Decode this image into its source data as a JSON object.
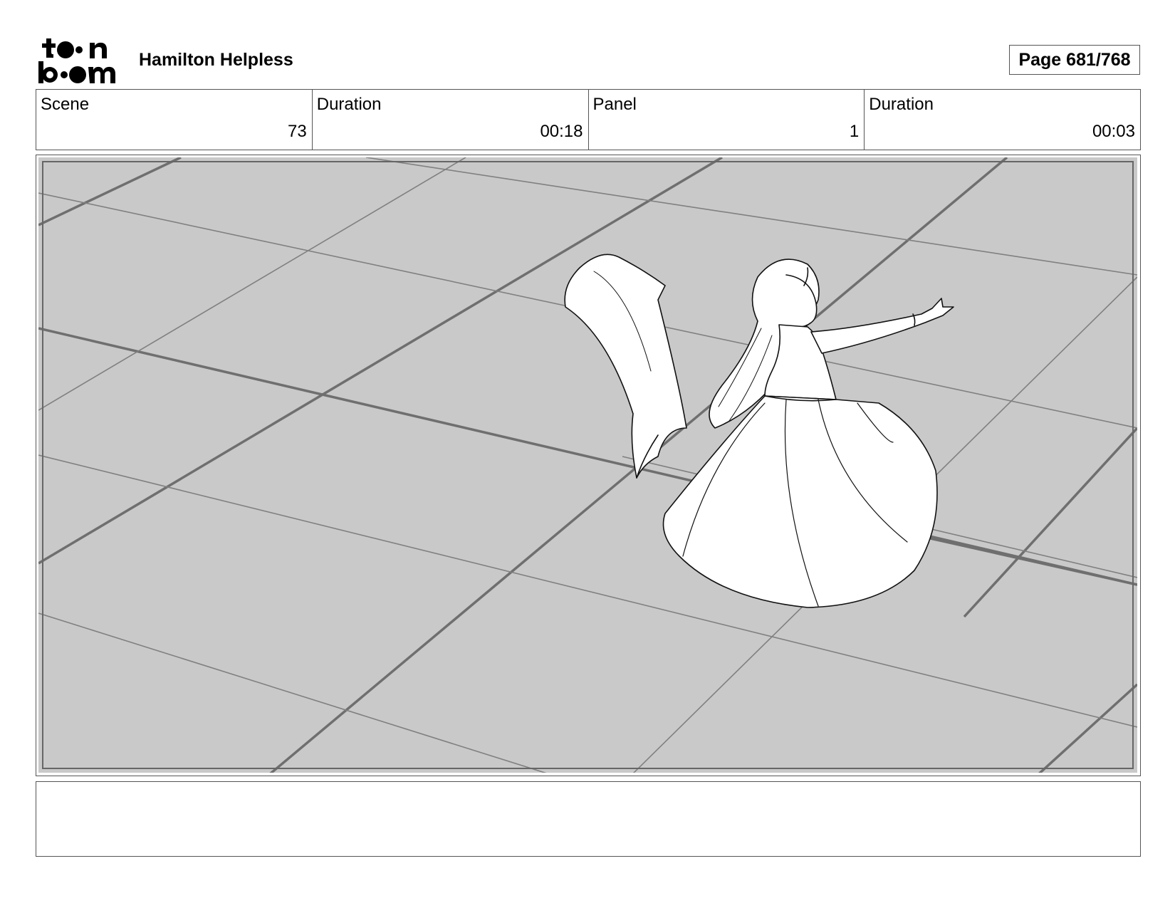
{
  "header": {
    "logo_text_top": "toon",
    "logo_text_bottom": "boom",
    "title": "Hamilton Helpless",
    "page_label": "Page",
    "page_value": "681/768"
  },
  "info": {
    "scene_label": "Scene",
    "scene_value": "73",
    "scene_duration_label": "Duration",
    "scene_duration_value": "00:18",
    "panel_label": "Panel",
    "panel_value": "1",
    "panel_duration_label": "Duration",
    "panel_duration_value": "00:03"
  },
  "notes": {
    "text": ""
  }
}
